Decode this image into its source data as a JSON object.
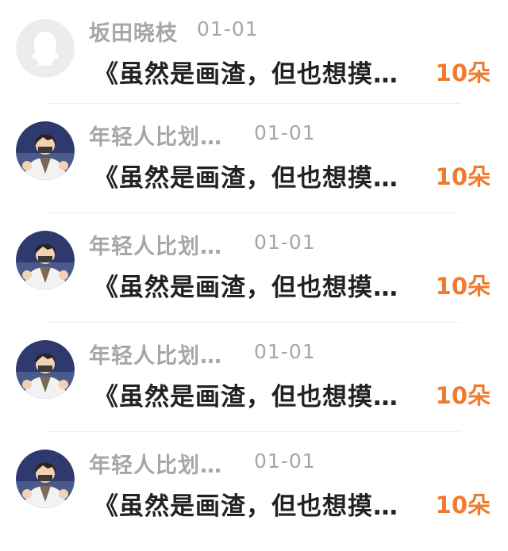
{
  "messages": [
    {
      "name": "坂田晓枝",
      "time": "01-01",
      "text": "《虽然是画渣，但也想摸…",
      "gift": "10朵",
      "avatar": "default-avatar"
    },
    {
      "name": "年轻人比划…",
      "time": "01-01",
      "text": "《虽然是画渣，但也想摸…",
      "gift": "10朵",
      "avatar": "anime-character-avatar"
    },
    {
      "name": "年轻人比划…",
      "time": "01-01",
      "text": "《虽然是画渣，但也想摸…",
      "gift": "10朵",
      "avatar": "anime-character-avatar"
    },
    {
      "name": "年轻人比划…",
      "time": "01-01",
      "text": "《虽然是画渣，但也想摸…",
      "gift": "10朵",
      "avatar": "anime-character-avatar"
    },
    {
      "name": "年轻人比划…",
      "time": "01-01",
      "text": "《虽然是画渣，但也想摸…",
      "gift": "10朵",
      "avatar": "anime-character-avatar"
    }
  ],
  "colors": {
    "name": "#a6a6a6",
    "message": "#222222",
    "gift": "#f07a2e"
  }
}
